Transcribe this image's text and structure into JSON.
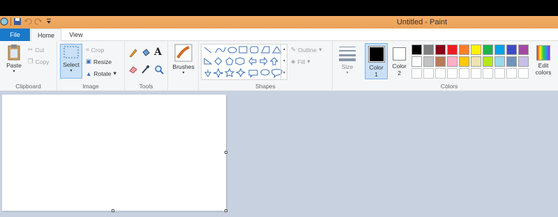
{
  "window": {
    "title": "Untitled - Paint"
  },
  "tabs": {
    "file": "File",
    "home": "Home",
    "view": "View"
  },
  "clipboard": {
    "paste": "Paste",
    "cut": "Cut",
    "copy": "Copy",
    "label": "Clipboard"
  },
  "image": {
    "select": "Select",
    "crop": "Crop",
    "resize": "Resize",
    "rotate": "Rotate",
    "label": "Image"
  },
  "tools": {
    "label": "Tools"
  },
  "brushes": {
    "label": "Brushes"
  },
  "shapes": {
    "outline": "Outline",
    "fill": "Fill",
    "label": "Shapes"
  },
  "size": {
    "label": "Size"
  },
  "color1": {
    "line1": "Color",
    "line2": "1"
  },
  "color2": {
    "line1": "Color",
    "line2": "2"
  },
  "colors": {
    "label": "Colors",
    "edit1": "Edit",
    "edit2": "colors",
    "row1": [
      "#000000",
      "#7f7f7f",
      "#880015",
      "#ed1c24",
      "#ff7f27",
      "#fff200",
      "#22b14c",
      "#00a2e8",
      "#3f48cc",
      "#a349a4"
    ],
    "row2": [
      "#ffffff",
      "#c3c3c3",
      "#b97a57",
      "#ffaec9",
      "#ffc90e",
      "#efe4b0",
      "#b5e61d",
      "#99d9ea",
      "#7092be",
      "#c8bfe7"
    ],
    "row3": [
      "#ffffff",
      "#ffffff",
      "#ffffff",
      "#ffffff",
      "#ffffff",
      "#ffffff",
      "#ffffff",
      "#ffffff",
      "#ffffff",
      "#ffffff"
    ],
    "color1_value": "#000000",
    "color2_value": "#ffffff"
  }
}
